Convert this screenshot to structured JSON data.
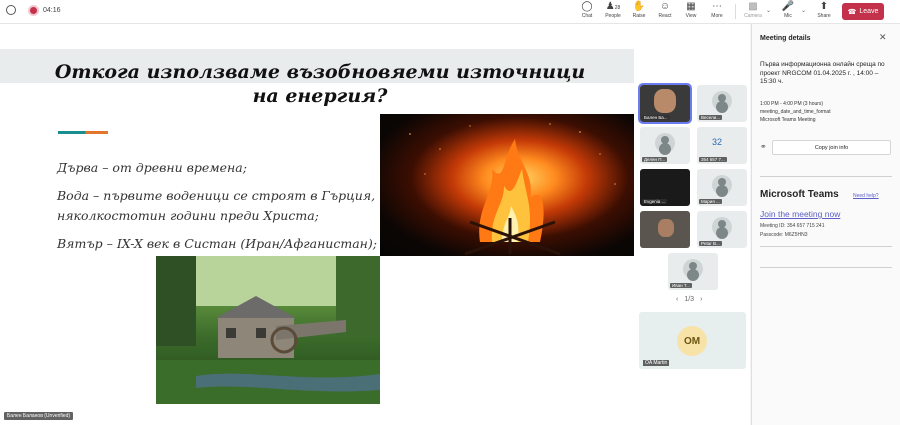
{
  "topbar": {
    "timer": "04:16",
    "buttons": [
      {
        "label": "Chat",
        "icon": "chat-icon"
      },
      {
        "label": "People",
        "icon": "people-icon",
        "count": "28"
      },
      {
        "label": "Raise",
        "icon": "hand-icon"
      },
      {
        "label": "React",
        "icon": "smile-icon"
      },
      {
        "label": "View",
        "icon": "grid-icon"
      },
      {
        "label": "More",
        "icon": "more-icon"
      },
      {
        "label": "Camera",
        "icon": "camera-off-icon"
      },
      {
        "label": "Mic",
        "icon": "mic-off-icon"
      },
      {
        "label": "Share",
        "icon": "share-icon"
      }
    ],
    "leave_label": "Leave"
  },
  "slide": {
    "title": "Откога използваме възобновяеми източници на енергия?",
    "bullets": [
      "Дърва – от древни времена;",
      "Вода – първите водeници се строят в Гърция, няколкостотин години преди Христа;",
      "Вятър – IX-X век в Систан (Иран/Афганистан);"
    ]
  },
  "participants": [
    {
      "name": "Бален Ба..."
    },
    {
      "name": "Весели..."
    },
    {
      "name": "Делян П..."
    },
    {
      "name": "354 657 7..."
    },
    {
      "name": "Evgenia ..."
    },
    {
      "name": "Мария ..."
    },
    {
      "name": ""
    },
    {
      "name": "Petar B..."
    },
    {
      "name": "Иван Т..."
    }
  ],
  "grid_counter": "32",
  "pager": {
    "text": "1/3"
  },
  "om": {
    "initials": "OM",
    "name": "OA Martin"
  },
  "self_tag": "Бален Баланов (Unverified)",
  "panel": {
    "title": "Meeting details",
    "description": "Първа информационна онлайн среща по проект NRGCOM 01.04.2025 г. , 14:00 – 15:30 ч.",
    "time": "1:00 PM - 4:00 PM (3 hours)",
    "format": "meeting_date_and_time_format",
    "type": "Microsoft Teams Meeting",
    "copy_label": "Copy join info",
    "teams_title": "Microsoft Teams",
    "need_help": "Need help?",
    "join_link": "Join the meeting now",
    "meeting_id": "Meeting ID: 354 657 715 241",
    "passcode": "Passcode: M6Z5HN3"
  },
  "colors": {
    "leave": "#c4314b",
    "link": "#5b5fc7",
    "accent_teal": "#1a8e8e",
    "accent_orange": "#e3762c"
  }
}
